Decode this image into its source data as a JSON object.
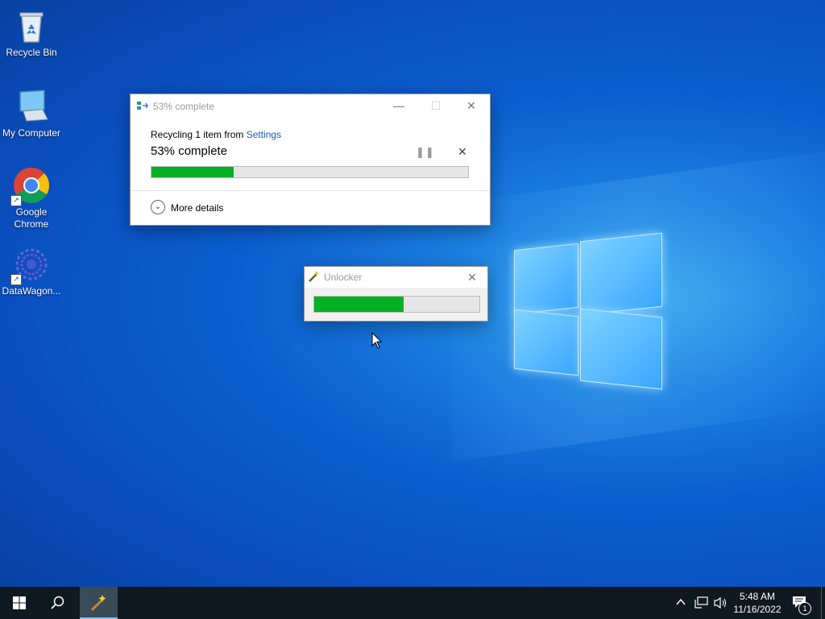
{
  "desktop": {
    "icons": [
      {
        "label": "Recycle Bin"
      },
      {
        "label": "My Computer"
      },
      {
        "label": "Google Chrome"
      },
      {
        "label": "DataWagon..."
      }
    ]
  },
  "copy_dialog": {
    "title": "53% complete",
    "recycling_prefix": "Recycling 1 item from ",
    "source_link": "Settings",
    "percent_text": "53% complete",
    "progress": 0.26,
    "more_details": "More details"
  },
  "unlocker_dialog": {
    "title": "Unlocker",
    "progress": 0.54
  },
  "taskbar": {
    "time": "5:48 AM",
    "date": "11/16/2022",
    "notification_count": "1"
  },
  "colors": {
    "progress_green": "#06b025",
    "link_blue": "#1a5fb4",
    "taskbar_bg": "#101820"
  }
}
